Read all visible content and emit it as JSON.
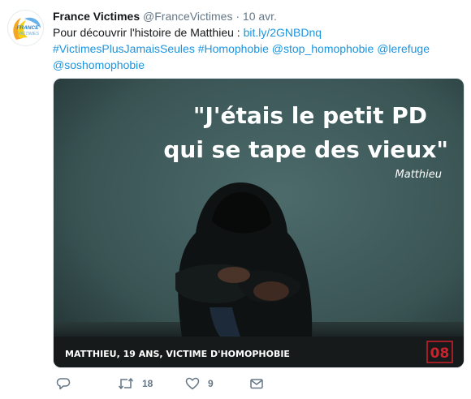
{
  "tweet": {
    "author_name": "France Victimes",
    "author_handle": "@FranceVictimes",
    "separator": "·",
    "timestamp": "10 avr.",
    "text_intro": "Pour découvrir l'histoire de Matthieu : ",
    "link": "bit.ly/2GNBDnq",
    "tags": [
      "#VictimesPlusJamaisSeules",
      "#Homophobie",
      "@stop_homophobie",
      "@lerefuge",
      "@soshomophobie"
    ]
  },
  "avatar": {
    "logo_line1": "FRANCE",
    "logo_line2": "VICTIMES"
  },
  "media": {
    "quote_line1": "\"J'étais le petit PD",
    "quote_line2": "qui se tape des vieux\"",
    "attribution": "Matthieu",
    "caption": "MATTHIEU, 19 ANS, VICTIME D'HOMOPHOBIE",
    "channel_logo": "08",
    "colors": {
      "background": "#3b5556",
      "caption_bar": "#161a1a",
      "logo_red": "#d0202a"
    }
  },
  "actions": {
    "reply_icon": "reply-icon",
    "retweet_icon": "retweet-icon",
    "retweet_count": "18",
    "like_icon": "heart-icon",
    "like_count": "9",
    "dm_icon": "envelope-icon"
  }
}
